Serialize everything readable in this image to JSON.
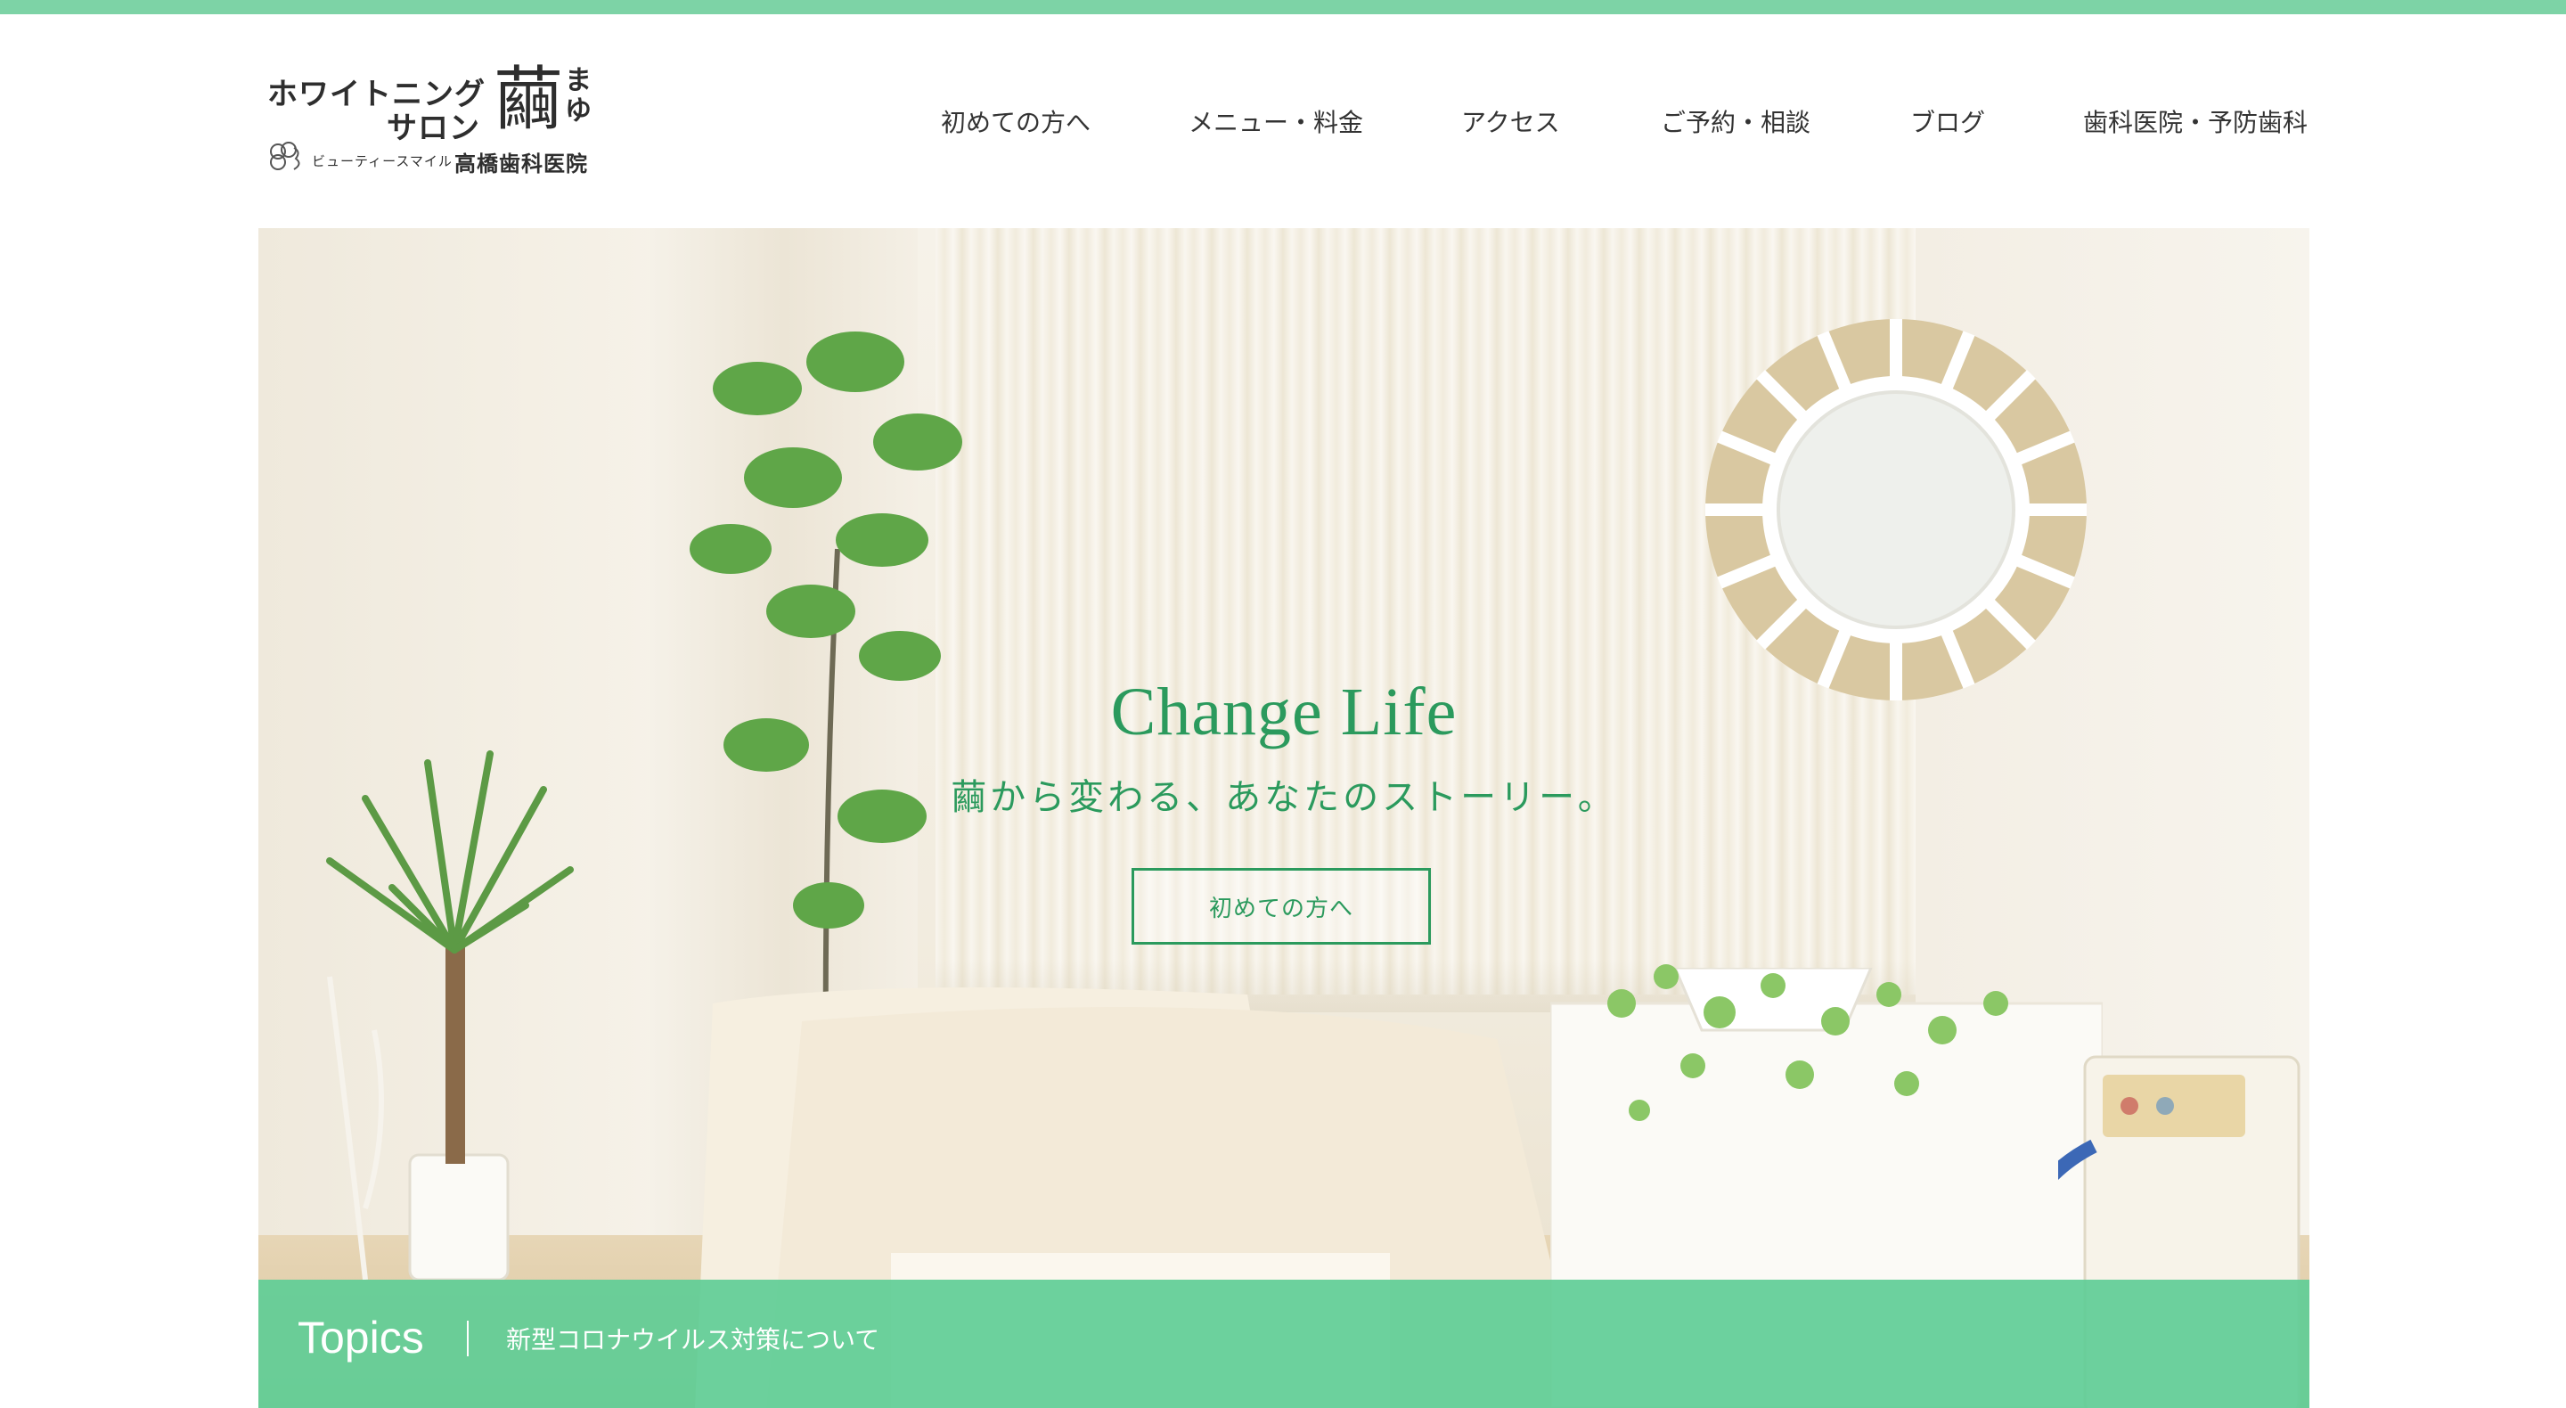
{
  "brand": {
    "logo_line1": "ホワイトニング",
    "logo_line2": "サロン",
    "logo_kanji": "繭",
    "logo_kana": "まゆ",
    "logo_sub": "ビューティースマイル",
    "logo_clinic": "高橋歯科医院"
  },
  "nav": {
    "items": [
      {
        "label": "初めての方へ"
      },
      {
        "label": "メニュー・料金"
      },
      {
        "label": "アクセス"
      },
      {
        "label": "ご予約・相談"
      },
      {
        "label": "ブログ"
      },
      {
        "label": "歯科医院・予防歯科"
      }
    ]
  },
  "hero": {
    "title": "Change Life",
    "subtitle": "繭から変わる、あなたのストーリー。",
    "button_label": "初めての方へ"
  },
  "topics": {
    "label": "Topics",
    "text": "新型コロナウイルス対策について"
  },
  "colors": {
    "accent": "#2b9a5d",
    "topbar": "#7dd3a6",
    "topics_bg": "#60cd96"
  }
}
